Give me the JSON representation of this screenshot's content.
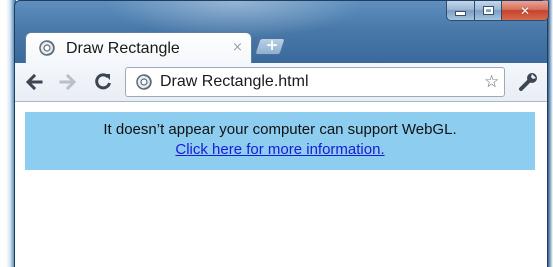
{
  "window": {
    "caption_buttons": {
      "minimize_icon": "minimize-icon",
      "maximize_icon": "maximize-icon",
      "close_icon": "close-icon"
    },
    "colors": {
      "frame": "#3b6b9c",
      "close_button": "#c4432c",
      "webgl_box": "#8dcdf0",
      "link": "#1a1ad8"
    }
  },
  "tab": {
    "favicon": "page-globe-icon",
    "title": "Draw Rectangle",
    "close_glyph": "×",
    "new_tab_glyph": "+"
  },
  "toolbar": {
    "back_icon": "back-arrow-icon",
    "forward_icon": "forward-arrow-icon",
    "reload_icon": "reload-icon",
    "omnibox": {
      "page_icon": "page-globe-icon",
      "text": "Draw Rectangle.html"
    },
    "bookmark_glyph": "☆",
    "wrench_icon": "wrench-icon"
  },
  "content": {
    "webgl_message": "It doesn’t appear your computer can support WebGL.",
    "webgl_link": "Click here for more information."
  }
}
